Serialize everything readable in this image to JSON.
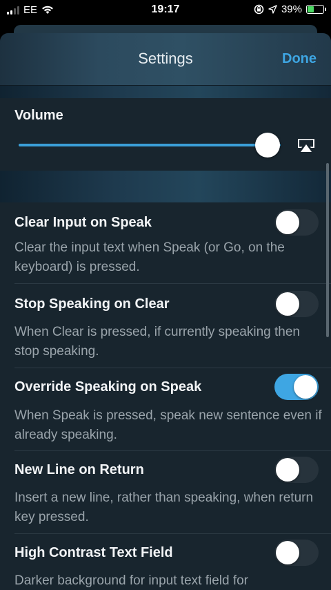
{
  "status_bar": {
    "carrier": "EE",
    "time": "19:17",
    "battery_percent": "39%",
    "battery_level": 0.39,
    "icons": [
      "signal-icon",
      "wifi-icon",
      "orientation-lock-icon",
      "location-icon",
      "charging-battery-icon"
    ]
  },
  "header": {
    "title": "Settings",
    "done_label": "Done"
  },
  "volume": {
    "label": "Volume",
    "level": 0.95,
    "airplay_icon": "airplay-icon"
  },
  "settings": [
    {
      "title": "Clear Input on Speak",
      "description": "Clear the input text when Speak (or Go, on the keyboard) is pressed.",
      "enabled": false
    },
    {
      "title": "Stop Speaking on Clear",
      "description": "When Clear is pressed, if currently speaking then stop speaking.",
      "enabled": false
    },
    {
      "title": "Override Speaking on Speak",
      "description": "When Speak is pressed, speak new sentence even if already speaking.",
      "enabled": true
    },
    {
      "title": "New Line on Return",
      "description": "Insert a new line, rather than speaking, when return key pressed.",
      "enabled": false
    },
    {
      "title": "High Contrast Text Field",
      "description": "Darker background for input text field for",
      "enabled": false
    }
  ],
  "colors": {
    "accent": "#3ea6e3",
    "background": "#18252e",
    "toggle_off": "#27333c"
  }
}
